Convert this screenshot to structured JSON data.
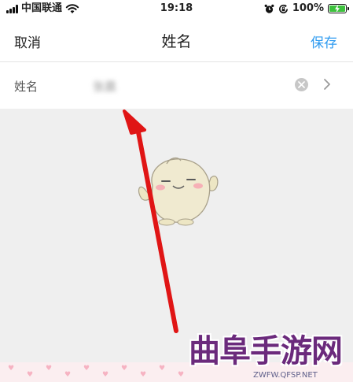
{
  "status_bar": {
    "carrier": "中国联通",
    "time": "19:18",
    "battery_percent": "100%",
    "battery_level": 1.0,
    "icons": [
      "signal-bars-icon",
      "wifi-icon",
      "alarm-icon",
      "orientation-lock-icon",
      "battery-charging-icon"
    ]
  },
  "nav": {
    "cancel_label": "取消",
    "title": "姓名",
    "save_label": "保存"
  },
  "name_field": {
    "label": "姓名",
    "value": "张晨",
    "clear_icon": "clear-circle-icon",
    "chevron_icon": "chevron-right-icon"
  },
  "watermark": {
    "title": "曲阜手游网",
    "url": "ZWFW.QFSP.NET"
  },
  "colors": {
    "accent": "#2f9bf0",
    "arrow": "#e01515",
    "battery": "#3dc13d",
    "watermark": "#6b2a7c"
  }
}
